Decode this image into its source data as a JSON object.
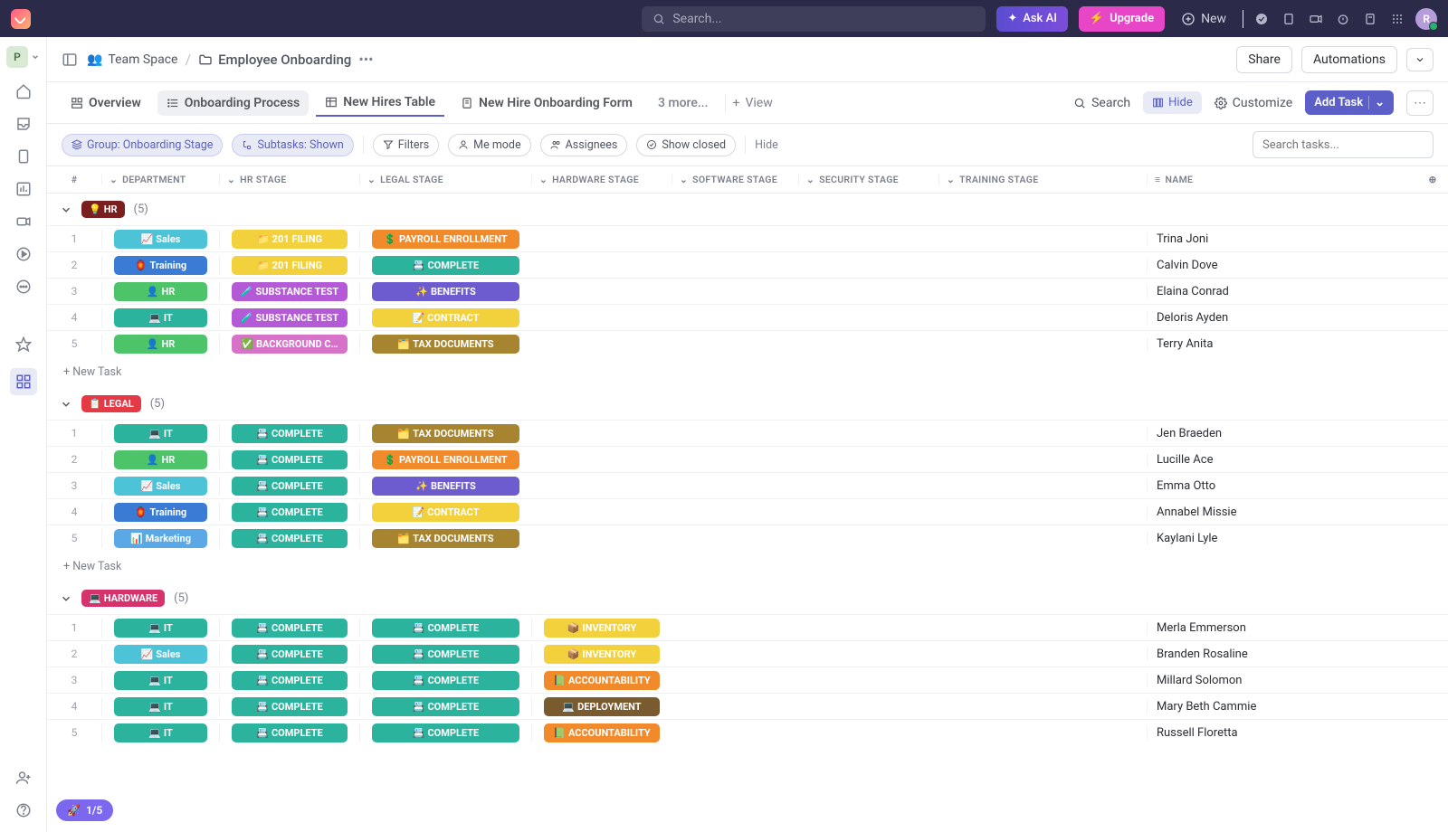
{
  "topbar": {
    "search_placeholder": "Search...",
    "ask_ai": "Ask AI",
    "upgrade": "Upgrade",
    "new": "New",
    "avatar_initial": "R"
  },
  "workspace_initial": "P",
  "breadcrumb": {
    "space": "Team Space",
    "folder": "Employee Onboarding",
    "share": "Share",
    "automations": "Automations"
  },
  "views": {
    "overview": "Overview",
    "process": "Onboarding Process",
    "table": "New Hires Table",
    "form": "New Hire Onboarding Form",
    "more": "3 more...",
    "view": "View",
    "search": "Search",
    "hide": "Hide",
    "customize": "Customize",
    "add_task": "Add Task"
  },
  "filters": {
    "group": "Group: Onboarding Stage",
    "subtasks": "Subtasks: Shown",
    "filters": "Filters",
    "me_mode": "Me mode",
    "assignees": "Assignees",
    "show_closed": "Show closed",
    "hide": "Hide",
    "search_placeholder": "Search tasks..."
  },
  "columns": {
    "num": "#",
    "dept": "DEPARTMENT",
    "hr": "HR STAGE",
    "legal": "LEGAL STAGE",
    "hw": "HARDWARE STAGE",
    "sw": "SOFTWARE STAGE",
    "sec": "SECURITY STAGE",
    "train": "TRAINING STAGE",
    "name": "NAME"
  },
  "tags": {
    "sales": {
      "emoji": "📈",
      "label": "Sales",
      "bg": "#4dc3d8"
    },
    "training": {
      "emoji": "🏮",
      "label": "Training",
      "bg": "#3a7bd5"
    },
    "hr": {
      "emoji": "👤",
      "label": "HR",
      "bg": "#4dc36a"
    },
    "it": {
      "emoji": "💻",
      "label": "IT",
      "bg": "#2bb39e"
    },
    "marketing": {
      "emoji": "📊",
      "label": "Marketing",
      "bg": "#5aa9e6"
    },
    "201filing": {
      "emoji": "📁",
      "label": "201 FILING",
      "bg": "#f2d13c"
    },
    "substance": {
      "emoji": "🧪",
      "label": "SUBSTANCE TEST",
      "bg": "#b55ad6"
    },
    "background": {
      "emoji": "✅",
      "label": "BACKGROUND C…",
      "bg": "#d673c9"
    },
    "complete": {
      "emoji": "📇",
      "label": "COMPLETE",
      "bg": "#2bb39e"
    },
    "payroll": {
      "emoji": "💲",
      "label": "PAYROLL ENROLLMENT",
      "bg": "#f08a2a"
    },
    "benefits": {
      "emoji": "✨",
      "label": "BENEFITS",
      "bg": "#6d5bd0"
    },
    "contract": {
      "emoji": "📝",
      "label": "CONTRACT",
      "bg": "#f2d13c"
    },
    "taxdocs": {
      "emoji": "🗂️",
      "label": "TAX DOCUMENTS",
      "bg": "#a7842f"
    },
    "inventory": {
      "emoji": "📦",
      "label": "INVENTORY",
      "bg": "#f2d13c"
    },
    "accountability": {
      "emoji": "📗",
      "label": "ACCOUNTABILITY",
      "bg": "#f08a2a"
    },
    "deployment": {
      "emoji": "💻",
      "label": "DEPLOYMENT",
      "bg": "#7a5a2f"
    }
  },
  "groups": [
    {
      "badge": {
        "emoji": "💡",
        "label": "HR",
        "bg": "#7a1f1f"
      },
      "count": "(5)",
      "rows": [
        {
          "n": "1",
          "dept": "sales",
          "hr": "201filing",
          "legal": "payroll",
          "name": "Trina Joni"
        },
        {
          "n": "2",
          "dept": "training",
          "hr": "201filing",
          "legal": "complete",
          "name": "Calvin Dove"
        },
        {
          "n": "3",
          "dept": "hr",
          "hr": "substance",
          "legal": "benefits",
          "name": "Elaina Conrad"
        },
        {
          "n": "4",
          "dept": "it",
          "hr": "substance",
          "legal": "contract",
          "name": "Deloris Ayden"
        },
        {
          "n": "5",
          "dept": "hr",
          "hr": "background",
          "legal": "taxdocs",
          "name": "Terry Anita"
        }
      ]
    },
    {
      "badge": {
        "emoji": "📋",
        "label": "LEGAL",
        "bg": "#e63946"
      },
      "count": "(5)",
      "rows": [
        {
          "n": "1",
          "dept": "it",
          "hr": "complete",
          "legal": "taxdocs",
          "name": "Jen Braeden"
        },
        {
          "n": "2",
          "dept": "hr",
          "hr": "complete",
          "legal": "payroll",
          "name": "Lucille Ace"
        },
        {
          "n": "3",
          "dept": "sales",
          "hr": "complete",
          "legal": "benefits",
          "name": "Emma Otto"
        },
        {
          "n": "4",
          "dept": "training",
          "hr": "complete",
          "legal": "contract",
          "name": "Annabel Missie"
        },
        {
          "n": "5",
          "dept": "marketing",
          "hr": "complete",
          "legal": "taxdocs",
          "name": "Kaylani Lyle"
        }
      ]
    },
    {
      "badge": {
        "emoji": "💻",
        "label": "HARDWARE",
        "bg": "#d6336c"
      },
      "count": "(5)",
      "rows": [
        {
          "n": "1",
          "dept": "it",
          "hr": "complete",
          "legal": "complete",
          "hw": "inventory",
          "name": "Merla Emmerson"
        },
        {
          "n": "2",
          "dept": "sales",
          "hr": "complete",
          "legal": "complete",
          "hw": "inventory",
          "name": "Branden Rosaline"
        },
        {
          "n": "3",
          "dept": "it",
          "hr": "complete",
          "legal": "complete",
          "hw": "accountability",
          "name": "Millard Solomon"
        },
        {
          "n": "4",
          "dept": "it",
          "hr": "complete",
          "legal": "complete",
          "hw": "deployment",
          "name": "Mary Beth Cammie"
        },
        {
          "n": "5",
          "dept": "it",
          "hr": "complete",
          "legal": "complete",
          "hw": "accountability",
          "name": "Russell Floretta"
        }
      ]
    }
  ],
  "new_task_label": "+ New Task",
  "progress": "1/5"
}
